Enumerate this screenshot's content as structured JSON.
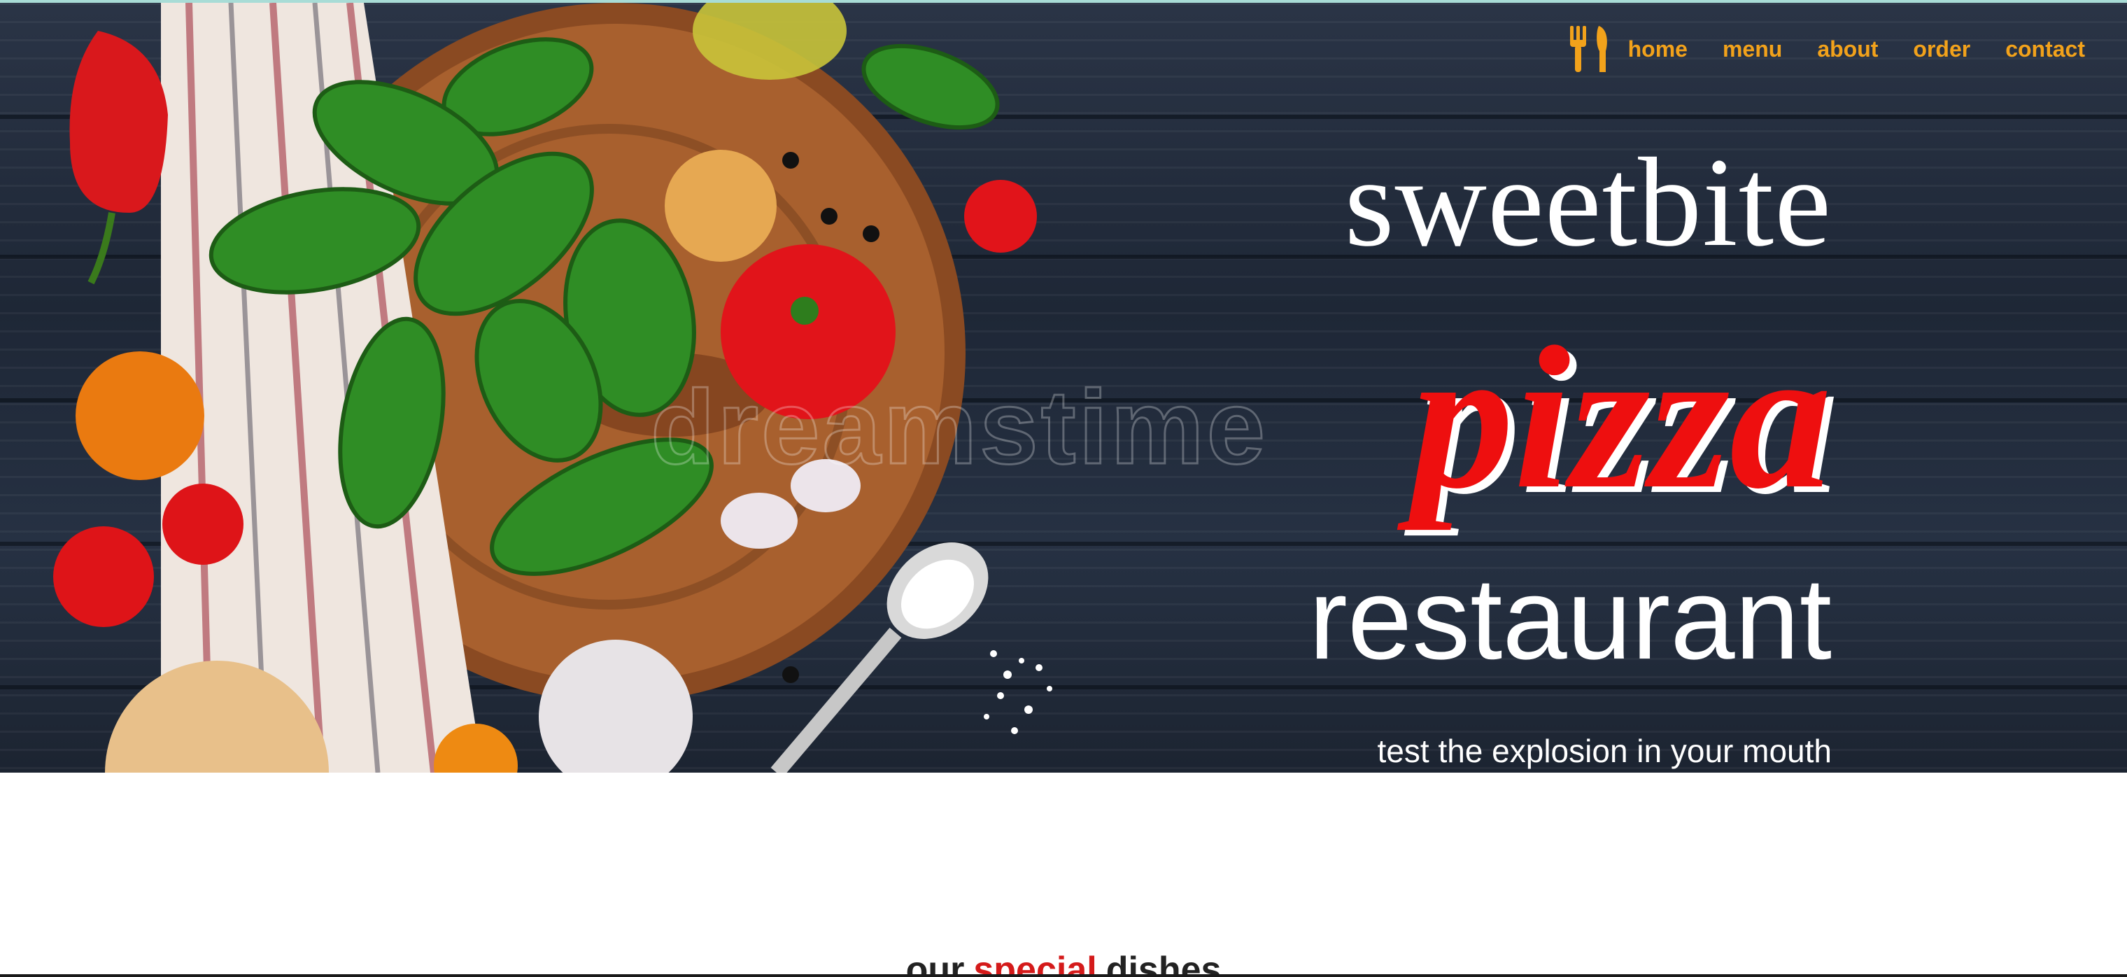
{
  "nav": {
    "logo_icon": "fork-spoon-icon",
    "items": [
      {
        "label": "home"
      },
      {
        "label": "menu"
      },
      {
        "label": "about"
      },
      {
        "label": "order"
      },
      {
        "label": "contact"
      }
    ],
    "link_color": "#f2a21b"
  },
  "hero": {
    "line1": "sweetbite",
    "line2": "pizza",
    "line3": "restaurant",
    "tagline": "test the explosion in your mouth",
    "watermark": "dreamstime",
    "accent_color": "#ee0f0f",
    "background_color": "#222b3b"
  },
  "section": {
    "heading_word1": "our",
    "heading_word2": "special",
    "heading_word3": "dishes",
    "highlight_color": "#d41a1a"
  }
}
